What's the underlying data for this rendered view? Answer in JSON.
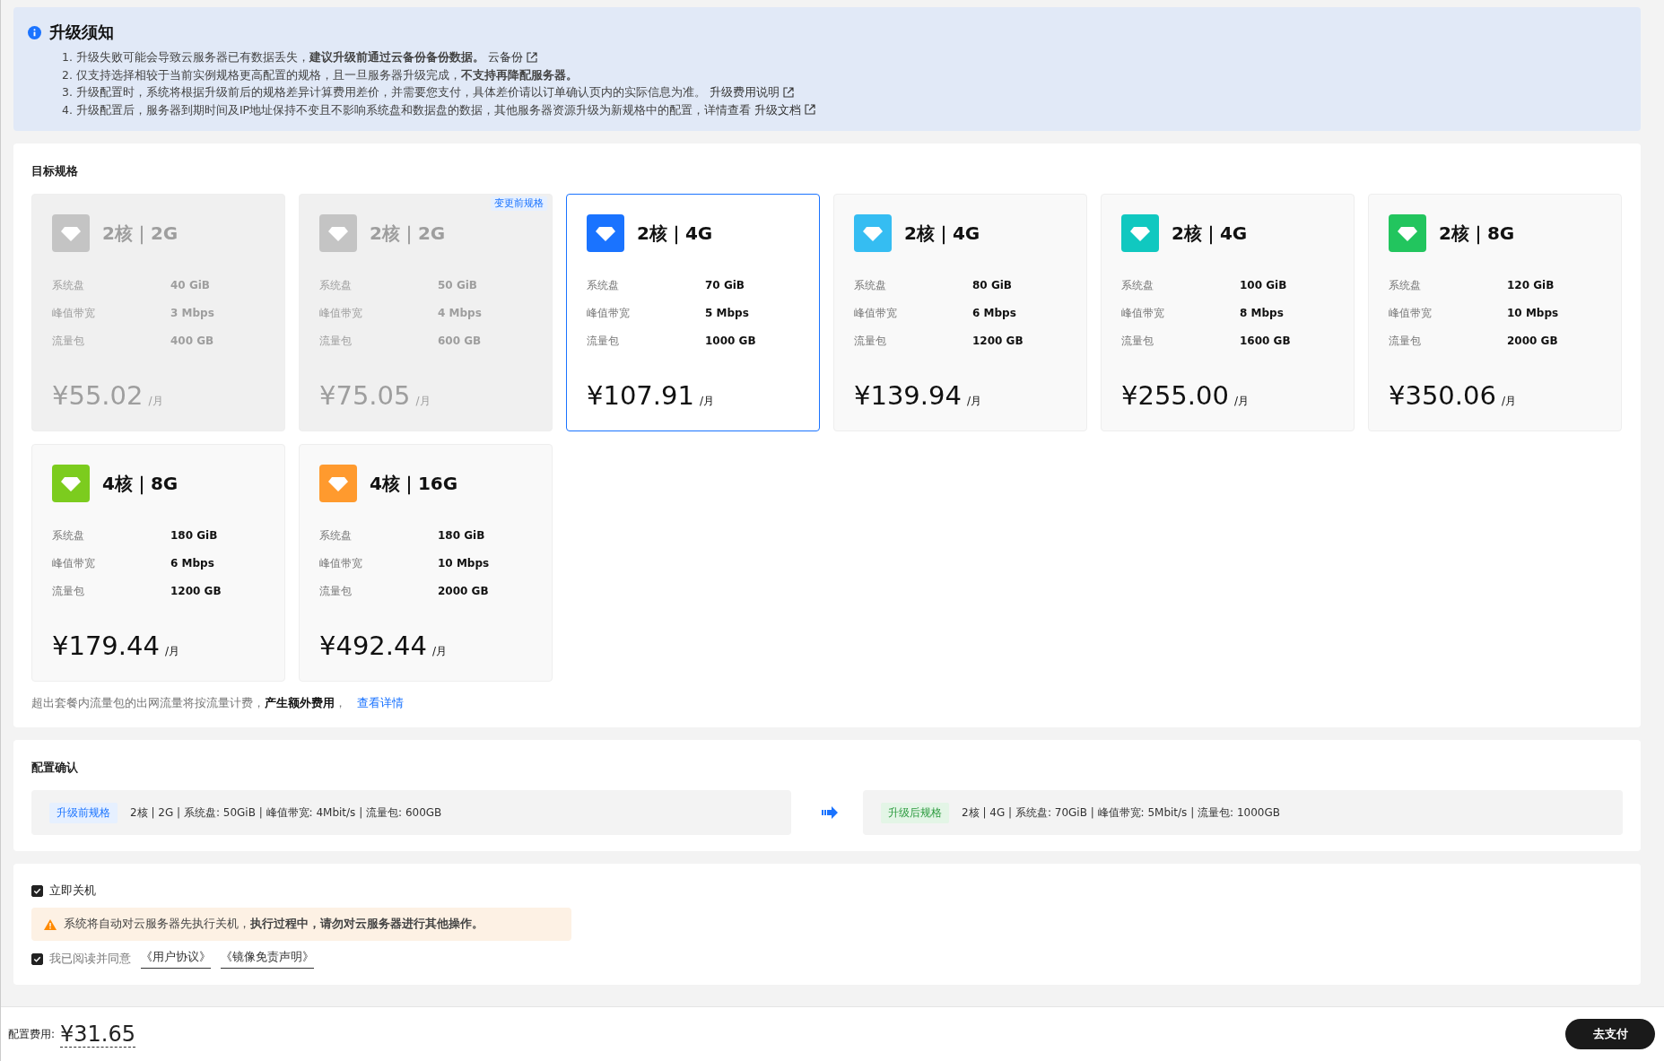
{
  "notice": {
    "title": "升级须知",
    "items": [
      {
        "text": "1. 升级失败可能会导致云服务器已有数据丢失，**建议升级前通过云备份备份数据。**",
        "link": "云备份"
      },
      {
        "text": "2. 仅支持选择相较于当前实例规格更高配置的规格，且一旦服务器升级完成，**不支持再降配服务器。**"
      },
      {
        "text": "3. 升级配置时，系统将根据升级前后的规格差异计算费用差价，并需要您支付，具体差价请以订单确认页内的实际信息为准。",
        "link": "升级费用说明"
      },
      {
        "text": "4. 升级配置后，服务器到期时间及IP地址保持不变且不影响系统盘和数据盘的数据，其他服务器资源升级为新规格中的配置，详情查看",
        "link": "升级文档"
      }
    ]
  },
  "target": {
    "title": "目标规格",
    "plans": [
      {
        "name": "2核｜2G",
        "disabled": true,
        "selected": false,
        "color": "#c4c4c4",
        "specs": [
          [
            "系统盘",
            "40 GiB"
          ],
          [
            "峰值带宽",
            "3 Mbps"
          ],
          [
            "流量包",
            "400 GB"
          ]
        ],
        "price": "¥55.02",
        "unit": "/月"
      },
      {
        "name": "2核｜2G",
        "disabled": true,
        "selected": false,
        "color": "#c4c4c4",
        "badge": "变更前规格",
        "specs": [
          [
            "系统盘",
            "50 GiB"
          ],
          [
            "峰值带宽",
            "4 Mbps"
          ],
          [
            "流量包",
            "600 GB"
          ]
        ],
        "price": "¥75.05",
        "unit": "/月"
      },
      {
        "name": "2核｜4G",
        "disabled": false,
        "selected": true,
        "color": "#1a73ff",
        "specs": [
          [
            "系统盘",
            "70 GiB"
          ],
          [
            "峰值带宽",
            "5 Mbps"
          ],
          [
            "流量包",
            "1000 GB"
          ]
        ],
        "price": "¥107.91",
        "unit": "/月"
      },
      {
        "name": "2核｜4G",
        "disabled": false,
        "selected": false,
        "color": "#35bdf2",
        "specs": [
          [
            "系统盘",
            "80 GiB"
          ],
          [
            "峰值带宽",
            "6 Mbps"
          ],
          [
            "流量包",
            "1200 GB"
          ]
        ],
        "price": "¥139.94",
        "unit": "/月"
      },
      {
        "name": "2核｜4G",
        "disabled": false,
        "selected": false,
        "color": "#10c8c0",
        "specs": [
          [
            "系统盘",
            "100 GiB"
          ],
          [
            "峰值带宽",
            "8 Mbps"
          ],
          [
            "流量包",
            "1600 GB"
          ]
        ],
        "price": "¥255.00",
        "unit": "/月"
      },
      {
        "name": "2核｜8G",
        "disabled": false,
        "selected": false,
        "color": "#22c55e",
        "specs": [
          [
            "系统盘",
            "120 GiB"
          ],
          [
            "峰值带宽",
            "10 Mbps"
          ],
          [
            "流量包",
            "2000 GB"
          ]
        ],
        "price": "¥350.06",
        "unit": "/月"
      },
      {
        "name": "4核｜8G",
        "disabled": false,
        "selected": false,
        "color": "#7ccc1e",
        "specs": [
          [
            "系统盘",
            "180 GiB"
          ],
          [
            "峰值带宽",
            "6 Mbps"
          ],
          [
            "流量包",
            "1200 GB"
          ]
        ],
        "price": "¥179.44",
        "unit": "/月"
      },
      {
        "name": "4核｜16G",
        "disabled": false,
        "selected": false,
        "color": "#ff9a2e",
        "specs": [
          [
            "系统盘",
            "180 GiB"
          ],
          [
            "峰值带宽",
            "10 Mbps"
          ],
          [
            "流量包",
            "2000 GB"
          ]
        ],
        "price": "¥492.44",
        "unit": "/月"
      }
    ],
    "footnote": "超出套餐内流量包的出网流量将按流量计费，**产生额外费用**，",
    "footnote_link": "查看详情"
  },
  "confirm": {
    "title": "配置确认",
    "before": {
      "tag": "升级前规格",
      "text": "2核 | 2G | 系统盘: 50GiB | 峰值带宽: 4Mbit/s | 流量包: 600GB"
    },
    "after": {
      "tag": "升级后规格",
      "text": "2核 | 4G | 系统盘: 70GiB | 峰值带宽: 5Mbit/s | 流量包: 1000GB"
    }
  },
  "options": {
    "shutdown": {
      "label": "立即关机",
      "checked": true
    },
    "warning": "系统将自动对云服务器先执行关机，**执行过程中，请勿对云服务器进行其他操作。**",
    "agree": {
      "label": "我已阅读并同意",
      "checked": true,
      "links": [
        "《用户协议》",
        "《镜像免责声明》"
      ]
    }
  },
  "footer": {
    "label": "配置费用:",
    "price": "¥31.65",
    "button": "去支付"
  }
}
